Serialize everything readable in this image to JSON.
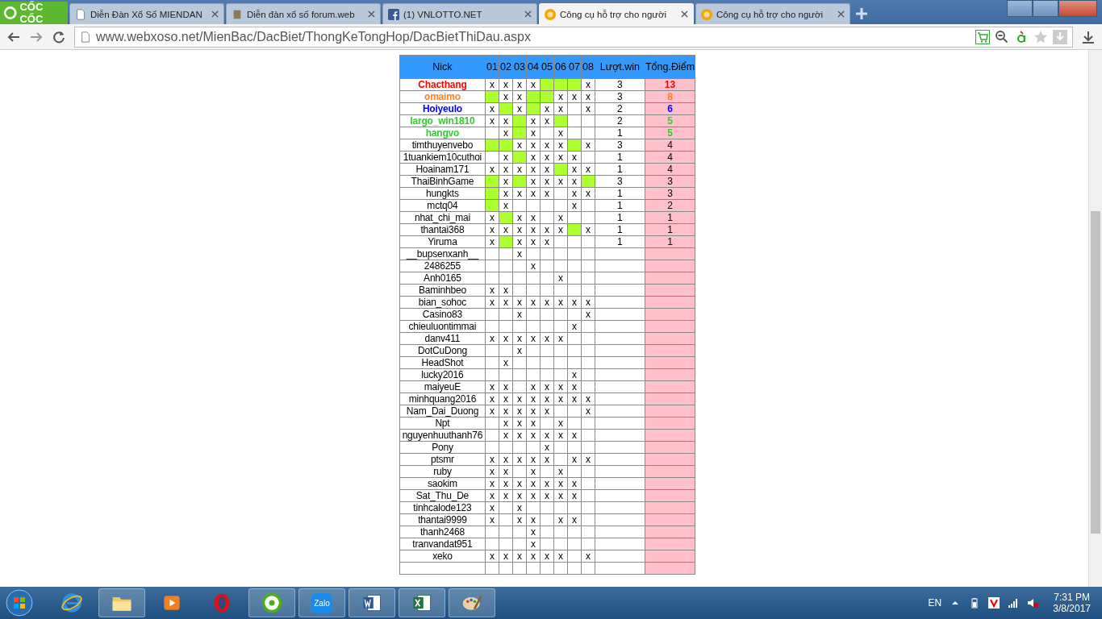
{
  "browser": {
    "logo": "CỐC CỐC",
    "tabs": [
      {
        "title": "Diễn Đàn Xổ Số MIENDAN",
        "selected": false
      },
      {
        "title": "Diễn đàn xổ số forum.web",
        "selected": false
      },
      {
        "title": "(1) VNLOTTO.NET",
        "selected": false
      },
      {
        "title": "Công cụ hỗ trợ cho người",
        "selected": true
      },
      {
        "title": "Công cụ hỗ trợ cho người",
        "selected": false
      }
    ],
    "address": "www.webxoso.net/MienBac/DacBiet/ThongKeTongHop/DacBietThiDau.aspx"
  },
  "table": {
    "columns": [
      "Nick",
      "01",
      "02",
      "03",
      "04",
      "05",
      "06",
      "07",
      "08",
      "Lượt.win",
      "Tổng.Điểm"
    ],
    "rows": [
      {
        "cells": [
          {
            "text": "Chacthang",
            "color": "#ff0000"
          },
          {
            "text": "x",
            "hit": false
          },
          {
            "text": "x",
            "hit": false
          },
          {
            "text": "x",
            "hit": false
          },
          {
            "text": "x",
            "hit": false
          },
          {
            "hit": true
          },
          {
            "hit": true
          },
          {
            "hit": true
          },
          {
            "text": "x",
            "hit": false
          },
          {
            "text": "3"
          },
          {
            "text": "13",
            "color": "#ff0000"
          }
        ]
      },
      {
        "cells": [
          {
            "text": "omaimo",
            "color": "#ff7f27"
          },
          {
            "hit": true
          },
          {
            "text": "x",
            "hit": false
          },
          {
            "text": "x",
            "hit": false
          },
          {
            "hit": true
          },
          {
            "hit": true
          },
          {
            "text": "x",
            "hit": false
          },
          {
            "text": "x",
            "hit": false
          },
          {
            "text": "x",
            "hit": false
          },
          {
            "text": "3"
          },
          {
            "text": "8",
            "color": "#ff7f27"
          }
        ]
      },
      {
        "cells": [
          {
            "text": "Hoiyeulo",
            "color": "#0000ff"
          },
          {
            "text": "x",
            "hit": false
          },
          {
            "hit": true
          },
          {
            "text": "x",
            "hit": false
          },
          {
            "hit": true
          },
          {
            "text": "x",
            "hit": false
          },
          {
            "text": "x",
            "hit": false
          },
          {
            "hit": false
          },
          {
            "text": "x",
            "hit": false
          },
          {
            "text": "2"
          },
          {
            "text": "6",
            "color": "#0000ff"
          }
        ]
      },
      {
        "cells": [
          {
            "text": "largo_win1810",
            "color": "#33cc33"
          },
          {
            "text": "x",
            "hit": false
          },
          {
            "text": "x",
            "hit": false
          },
          {
            "hit": true
          },
          {
            "text": "x",
            "hit": false
          },
          {
            "text": "x",
            "hit": false
          },
          {
            "hit": true
          },
          {
            "hit": false
          },
          {
            "hit": false
          },
          {
            "text": "2"
          },
          {
            "text": "5",
            "color": "#33cc33"
          }
        ]
      },
      {
        "cells": [
          {
            "text": "hangvo",
            "color": "#33cc33"
          },
          {
            "hit": false
          },
          {
            "text": "x",
            "hit": false
          },
          {
            "hit": true
          },
          {
            "text": "x",
            "hit": false
          },
          {
            "hit": false
          },
          {
            "text": "x",
            "hit": false
          },
          {
            "hit": false
          },
          {
            "hit": false
          },
          {
            "text": "1"
          },
          {
            "text": "5",
            "color": "#33cc33"
          }
        ]
      },
      {
        "cells": [
          {
            "text": "timthuyenvebo"
          },
          {
            "hit": true
          },
          {
            "hit": true
          },
          {
            "text": "x",
            "hit": false
          },
          {
            "text": "x",
            "hit": false
          },
          {
            "text": "x",
            "hit": false
          },
          {
            "text": "x",
            "hit": false
          },
          {
            "hit": true
          },
          {
            "text": "x",
            "hit": false
          },
          {
            "text": "3"
          },
          {
            "text": "4"
          }
        ]
      },
      {
        "cells": [
          {
            "text": "1tuankiem10cuthoi"
          },
          {
            "hit": false
          },
          {
            "text": "x",
            "hit": false
          },
          {
            "hit": true
          },
          {
            "text": "x",
            "hit": false
          },
          {
            "text": "x",
            "hit": false
          },
          {
            "text": "x",
            "hit": false
          },
          {
            "text": "x",
            "hit": false
          },
          {
            "hit": false
          },
          {
            "text": "1"
          },
          {
            "text": "4"
          }
        ]
      },
      {
        "cells": [
          {
            "text": "Hoainam171"
          },
          {
            "text": "x",
            "hit": false
          },
          {
            "text": "x",
            "hit": false
          },
          {
            "text": "x",
            "hit": false
          },
          {
            "text": "x",
            "hit": false
          },
          {
            "text": "x",
            "hit": false
          },
          {
            "hit": true
          },
          {
            "text": "x",
            "hit": false
          },
          {
            "text": "x",
            "hit": false
          },
          {
            "text": "1"
          },
          {
            "text": "4"
          }
        ]
      },
      {
        "cells": [
          {
            "text": "ThaiBinhGame"
          },
          {
            "hit": true
          },
          {
            "text": "x",
            "hit": false
          },
          {
            "hit": true
          },
          {
            "text": "x",
            "hit": false
          },
          {
            "text": "x",
            "hit": false
          },
          {
            "text": "x",
            "hit": false
          },
          {
            "text": "x",
            "hit": false
          },
          {
            "hit": true
          },
          {
            "text": "3"
          },
          {
            "text": "3"
          }
        ]
      },
      {
        "cells": [
          {
            "text": "hungkts"
          },
          {
            "hit": true
          },
          {
            "text": "x",
            "hit": false
          },
          {
            "text": "x",
            "hit": false
          },
          {
            "text": "x",
            "hit": false
          },
          {
            "text": "x",
            "hit": false
          },
          {
            "hit": false
          },
          {
            "text": "x",
            "hit": false
          },
          {
            "text": "x",
            "hit": false
          },
          {
            "text": "1"
          },
          {
            "text": "3"
          }
        ]
      },
      {
        "cells": [
          {
            "text": "mctq04"
          },
          {
            "hit": true
          },
          {
            "text": "x",
            "hit": false
          },
          {
            "hit": false
          },
          {
            "hit": false
          },
          {
            "hit": false
          },
          {
            "hit": false
          },
          {
            "text": "x",
            "hit": false
          },
          {
            "hit": false
          },
          {
            "text": "1"
          },
          {
            "text": "2"
          }
        ]
      },
      {
        "cells": [
          {
            "text": "nhat_chi_mai"
          },
          {
            "text": "x",
            "hit": false
          },
          {
            "hit": true
          },
          {
            "text": "x",
            "hit": false
          },
          {
            "text": "x",
            "hit": false
          },
          {
            "hit": false
          },
          {
            "text": "x",
            "hit": false
          },
          {
            "hit": false
          },
          {
            "hit": false
          },
          {
            "text": "1"
          },
          {
            "text": "1"
          }
        ]
      },
      {
        "cells": [
          {
            "text": "thantai368"
          },
          {
            "text": "x",
            "hit": false
          },
          {
            "text": "x",
            "hit": false
          },
          {
            "text": "x",
            "hit": false
          },
          {
            "text": "x",
            "hit": false
          },
          {
            "text": "x",
            "hit": false
          },
          {
            "text": "x",
            "hit": false
          },
          {
            "hit": true
          },
          {
            "text": "x",
            "hit": false
          },
          {
            "text": "1"
          },
          {
            "text": "1"
          }
        ]
      },
      {
        "cells": [
          {
            "text": "Yiruma"
          },
          {
            "text": "x",
            "hit": false
          },
          {
            "hit": true
          },
          {
            "text": "x",
            "hit": false
          },
          {
            "text": "x",
            "hit": false
          },
          {
            "text": "x",
            "hit": false
          },
          {
            "hit": false
          },
          {
            "hit": false
          },
          {
            "hit": false
          },
          {
            "text": "1"
          },
          {
            "text": "1"
          }
        ]
      },
      {
        "cells": [
          {
            "text": "__bupsenxanh__"
          },
          {
            "hit": false
          },
          {
            "hit": false
          },
          {
            "text": "x",
            "hit": false
          },
          {
            "hit": false
          },
          {
            "hit": false
          },
          {
            "hit": false
          },
          {
            "hit": false
          },
          {
            "hit": false
          },
          {},
          {}
        ]
      },
      {
        "cells": [
          {
            "text": "2486255"
          },
          {
            "hit": false
          },
          {
            "hit": false
          },
          {
            "hit": false
          },
          {
            "text": "x",
            "hit": false
          },
          {
            "hit": false
          },
          {
            "hit": false
          },
          {
            "hit": false
          },
          {
            "hit": false
          },
          {},
          {}
        ]
      },
      {
        "cells": [
          {
            "text": "Anh0165"
          },
          {
            "hit": false
          },
          {
            "hit": false
          },
          {
            "hit": false
          },
          {
            "hit": false
          },
          {
            "hit": false
          },
          {
            "text": "x",
            "hit": false
          },
          {
            "hit": false
          },
          {
            "hit": false
          },
          {},
          {}
        ]
      },
      {
        "cells": [
          {
            "text": "Baminhbeo"
          },
          {
            "text": "x",
            "hit": false
          },
          {
            "text": "x",
            "hit": false
          },
          {
            "hit": false
          },
          {
            "hit": false
          },
          {
            "hit": false
          },
          {
            "hit": false
          },
          {
            "hit": false
          },
          {
            "hit": false
          },
          {},
          {}
        ]
      },
      {
        "cells": [
          {
            "text": "bian_sohoc"
          },
          {
            "text": "x",
            "hit": false
          },
          {
            "text": "x",
            "hit": false
          },
          {
            "text": "x",
            "hit": false
          },
          {
            "text": "x",
            "hit": false
          },
          {
            "text": "x",
            "hit": false
          },
          {
            "text": "x",
            "hit": false
          },
          {
            "text": "x",
            "hit": false
          },
          {
            "text": "x",
            "hit": false
          },
          {},
          {}
        ]
      },
      {
        "cells": [
          {
            "text": "Casino83"
          },
          {
            "hit": false
          },
          {
            "hit": false
          },
          {
            "text": "x",
            "hit": false
          },
          {
            "hit": false
          },
          {
            "hit": false
          },
          {
            "hit": false
          },
          {
            "hit": false
          },
          {
            "text": "x",
            "hit": false
          },
          {},
          {}
        ]
      },
      {
        "cells": [
          {
            "text": "chieuluontimmai"
          },
          {
            "hit": false
          },
          {
            "hit": false
          },
          {
            "hit": false
          },
          {
            "hit": false
          },
          {
            "hit": false
          },
          {
            "hit": false
          },
          {
            "text": "x",
            "hit": false
          },
          {
            "hit": false
          },
          {},
          {}
        ]
      },
      {
        "cells": [
          {
            "text": "danv411"
          },
          {
            "text": "x",
            "hit": false
          },
          {
            "text": "x",
            "hit": false
          },
          {
            "text": "x",
            "hit": false
          },
          {
            "text": "x",
            "hit": false
          },
          {
            "text": "x",
            "hit": false
          },
          {
            "text": "x",
            "hit": false
          },
          {
            "hit": false
          },
          {
            "hit": false
          },
          {},
          {}
        ]
      },
      {
        "cells": [
          {
            "text": "DotCuDong"
          },
          {
            "hit": false
          },
          {
            "hit": false
          },
          {
            "text": "x",
            "hit": false
          },
          {
            "hit": false
          },
          {
            "hit": false
          },
          {
            "hit": false
          },
          {
            "hit": false
          },
          {
            "hit": false
          },
          {},
          {}
        ]
      },
      {
        "cells": [
          {
            "text": "HeadShot"
          },
          {
            "hit": false
          },
          {
            "text": "x",
            "hit": false
          },
          {
            "hit": false
          },
          {
            "hit": false
          },
          {
            "hit": false
          },
          {
            "hit": false
          },
          {
            "hit": false
          },
          {
            "hit": false
          },
          {},
          {}
        ]
      },
      {
        "cells": [
          {
            "text": "lucky2016"
          },
          {
            "hit": false
          },
          {
            "hit": false
          },
          {
            "hit": false
          },
          {
            "hit": false
          },
          {
            "hit": false
          },
          {
            "hit": false
          },
          {
            "text": "x",
            "hit": false
          },
          {
            "hit": false
          },
          {},
          {}
        ]
      },
      {
        "cells": [
          {
            "text": "maiyeuE"
          },
          {
            "text": "x",
            "hit": false
          },
          {
            "text": "x",
            "hit": false
          },
          {
            "hit": false
          },
          {
            "text": "x",
            "hit": false
          },
          {
            "text": "x",
            "hit": false
          },
          {
            "text": "x",
            "hit": false
          },
          {
            "text": "x",
            "hit": false
          },
          {
            "hit": false
          },
          {},
          {}
        ]
      },
      {
        "cells": [
          {
            "text": "minhquang2016"
          },
          {
            "text": "x",
            "hit": false
          },
          {
            "text": "x",
            "hit": false
          },
          {
            "text": "x",
            "hit": false
          },
          {
            "text": "x",
            "hit": false
          },
          {
            "text": "x",
            "hit": false
          },
          {
            "text": "x",
            "hit": false
          },
          {
            "text": "x",
            "hit": false
          },
          {
            "text": "x",
            "hit": false
          },
          {},
          {}
        ]
      },
      {
        "cells": [
          {
            "text": "Nam_Dai_Duong"
          },
          {
            "text": "x",
            "hit": false
          },
          {
            "text": "x",
            "hit": false
          },
          {
            "text": "x",
            "hit": false
          },
          {
            "text": "x",
            "hit": false
          },
          {
            "text": "x",
            "hit": false
          },
          {
            "hit": false
          },
          {
            "hit": false
          },
          {
            "text": "x",
            "hit": false
          },
          {},
          {}
        ]
      },
      {
        "cells": [
          {
            "text": "Npt"
          },
          {
            "hit": false
          },
          {
            "text": "x",
            "hit": false
          },
          {
            "text": "x",
            "hit": false
          },
          {
            "text": "x",
            "hit": false
          },
          {
            "hit": false
          },
          {
            "text": "x",
            "hit": false
          },
          {
            "hit": false
          },
          {
            "hit": false
          },
          {},
          {}
        ]
      },
      {
        "cells": [
          {
            "text": "nguyenhuuthanh76"
          },
          {
            "hit": false
          },
          {
            "text": "x",
            "hit": false
          },
          {
            "text": "x",
            "hit": false
          },
          {
            "text": "x",
            "hit": false
          },
          {
            "text": "x",
            "hit": false
          },
          {
            "text": "x",
            "hit": false
          },
          {
            "text": "x",
            "hit": false
          },
          {
            "hit": false
          },
          {},
          {}
        ]
      },
      {
        "cells": [
          {
            "text": "Pony"
          },
          {
            "hit": false
          },
          {
            "hit": false
          },
          {
            "hit": false
          },
          {
            "hit": false
          },
          {
            "text": "x",
            "hit": false
          },
          {
            "hit": false
          },
          {
            "hit": false
          },
          {
            "hit": false
          },
          {},
          {}
        ]
      },
      {
        "cells": [
          {
            "text": "ptsmr"
          },
          {
            "text": "x",
            "hit": false
          },
          {
            "text": "x",
            "hit": false
          },
          {
            "text": "x",
            "hit": false
          },
          {
            "text": "x",
            "hit": false
          },
          {
            "text": "x",
            "hit": false
          },
          {
            "hit": false
          },
          {
            "text": "x",
            "hit": false
          },
          {
            "text": "x",
            "hit": false
          },
          {},
          {}
        ]
      },
      {
        "cells": [
          {
            "text": "ruby"
          },
          {
            "text": "x",
            "hit": false
          },
          {
            "text": "x",
            "hit": false
          },
          {
            "hit": false
          },
          {
            "text": "x",
            "hit": false
          },
          {
            "hit": false
          },
          {
            "text": "x",
            "hit": false
          },
          {
            "hit": false
          },
          {
            "hit": false
          },
          {},
          {}
        ]
      },
      {
        "cells": [
          {
            "text": "saokim"
          },
          {
            "text": "x",
            "hit": false
          },
          {
            "text": "x",
            "hit": false
          },
          {
            "text": "x",
            "hit": false
          },
          {
            "text": "x",
            "hit": false
          },
          {
            "text": "x",
            "hit": false
          },
          {
            "text": "x",
            "hit": false
          },
          {
            "text": "x",
            "hit": false
          },
          {
            "hit": false
          },
          {},
          {}
        ]
      },
      {
        "cells": [
          {
            "text": "Sat_Thu_De"
          },
          {
            "text": "x",
            "hit": false
          },
          {
            "text": "x",
            "hit": false
          },
          {
            "text": "x",
            "hit": false
          },
          {
            "text": "x",
            "hit": false
          },
          {
            "text": "x",
            "hit": false
          },
          {
            "text": "x",
            "hit": false
          },
          {
            "text": "x",
            "hit": false
          },
          {
            "hit": false
          },
          {},
          {}
        ]
      },
      {
        "cells": [
          {
            "text": "tinhcalode123"
          },
          {
            "text": "x",
            "hit": false
          },
          {
            "hit": false
          },
          {
            "text": "x",
            "hit": false
          },
          {
            "hit": false
          },
          {
            "hit": false
          },
          {
            "hit": false
          },
          {
            "hit": false
          },
          {
            "hit": false
          },
          {},
          {}
        ]
      },
      {
        "cells": [
          {
            "text": "thantai9999"
          },
          {
            "text": "x",
            "hit": false
          },
          {
            "hit": false
          },
          {
            "text": "x",
            "hit": false
          },
          {
            "text": "x",
            "hit": false
          },
          {
            "hit": false
          },
          {
            "text": "x",
            "hit": false
          },
          {
            "text": "x",
            "hit": false
          },
          {
            "hit": false
          },
          {},
          {}
        ]
      },
      {
        "cells": [
          {
            "text": "thanh2468"
          },
          {
            "hit": false
          },
          {
            "hit": false
          },
          {
            "hit": false
          },
          {
            "text": "x",
            "hit": false
          },
          {
            "hit": false
          },
          {
            "hit": false
          },
          {
            "hit": false
          },
          {
            "hit": false
          },
          {},
          {}
        ]
      },
      {
        "cells": [
          {
            "text": "tranvandat951"
          },
          {
            "hit": false
          },
          {
            "hit": false
          },
          {
            "hit": false
          },
          {
            "text": "x",
            "hit": false
          },
          {
            "hit": false
          },
          {
            "hit": false
          },
          {
            "hit": false
          },
          {
            "hit": false
          },
          {},
          {}
        ]
      },
      {
        "cells": [
          {
            "text": "xeko"
          },
          {
            "text": "x",
            "hit": false
          },
          {
            "text": "x",
            "hit": false
          },
          {
            "text": "x",
            "hit": false
          },
          {
            "text": "x",
            "hit": false
          },
          {
            "text": "x",
            "hit": false
          },
          {
            "text": "x",
            "hit": false
          },
          {
            "hit": false
          },
          {
            "text": "x",
            "hit": false
          },
          {},
          {}
        ]
      },
      {
        "cells": [
          {},
          {
            "hit": false
          },
          {
            "hit": false
          },
          {
            "hit": false
          },
          {
            "hit": false
          },
          {
            "hit": false
          },
          {
            "hit": false
          },
          {
            "hit": false
          },
          {
            "hit": false
          },
          {},
          {}
        ]
      }
    ]
  },
  "taskbar": {
    "apps": [
      {
        "kind": "ie",
        "selected": false
      },
      {
        "kind": "folder",
        "selected": true
      },
      {
        "kind": "media",
        "selected": false
      },
      {
        "kind": "opera",
        "selected": false
      },
      {
        "kind": "coccoc",
        "selected": true
      },
      {
        "kind": "zalo",
        "selected": true,
        "label": "Zalo"
      },
      {
        "kind": "word",
        "selected": true
      },
      {
        "kind": "excel",
        "selected": true
      },
      {
        "kind": "paint",
        "selected": true
      }
    ],
    "language": "EN",
    "time": "7:31 PM",
    "date": "3/8/2017"
  }
}
